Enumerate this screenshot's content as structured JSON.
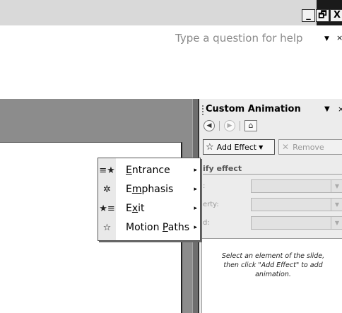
{
  "window": {
    "minimize_glyph": "_",
    "restore_glyph": "🗗",
    "close_glyph": "X"
  },
  "help": {
    "placeholder": "Type a question for help",
    "dropdown_glyph": "▼",
    "close_glyph": "×"
  },
  "task_pane": {
    "title": "Custom Animation",
    "dropdown_glyph": "▼",
    "close_glyph": "×",
    "nav": {
      "back_glyph": "◀",
      "forward_glyph": "▶",
      "home_glyph": "⌂"
    },
    "add_effect_label": "Add Effect",
    "add_effect_arrow": "▼",
    "remove_label": "Remove",
    "modify_label": "ify effect",
    "fields": [
      {
        "label": ":"
      },
      {
        "label": "erty:"
      },
      {
        "label": "d:"
      }
    ],
    "hint_lines": [
      "Select an element of the slide,",
      "then click \"Add Effect\" to add",
      "animation."
    ]
  },
  "menu": {
    "items": [
      {
        "label": "Entrance",
        "icon": "entrance-star-icon",
        "arrow": "▸"
      },
      {
        "label": "Emphasis",
        "icon": "emphasis-star-icon",
        "arrow": "▸"
      },
      {
        "label": "Exit",
        "icon": "exit-star-icon",
        "arrow": "▸"
      },
      {
        "label": "Motion Paths",
        "icon": "motion-path-star-icon",
        "arrow": "▸"
      }
    ]
  }
}
